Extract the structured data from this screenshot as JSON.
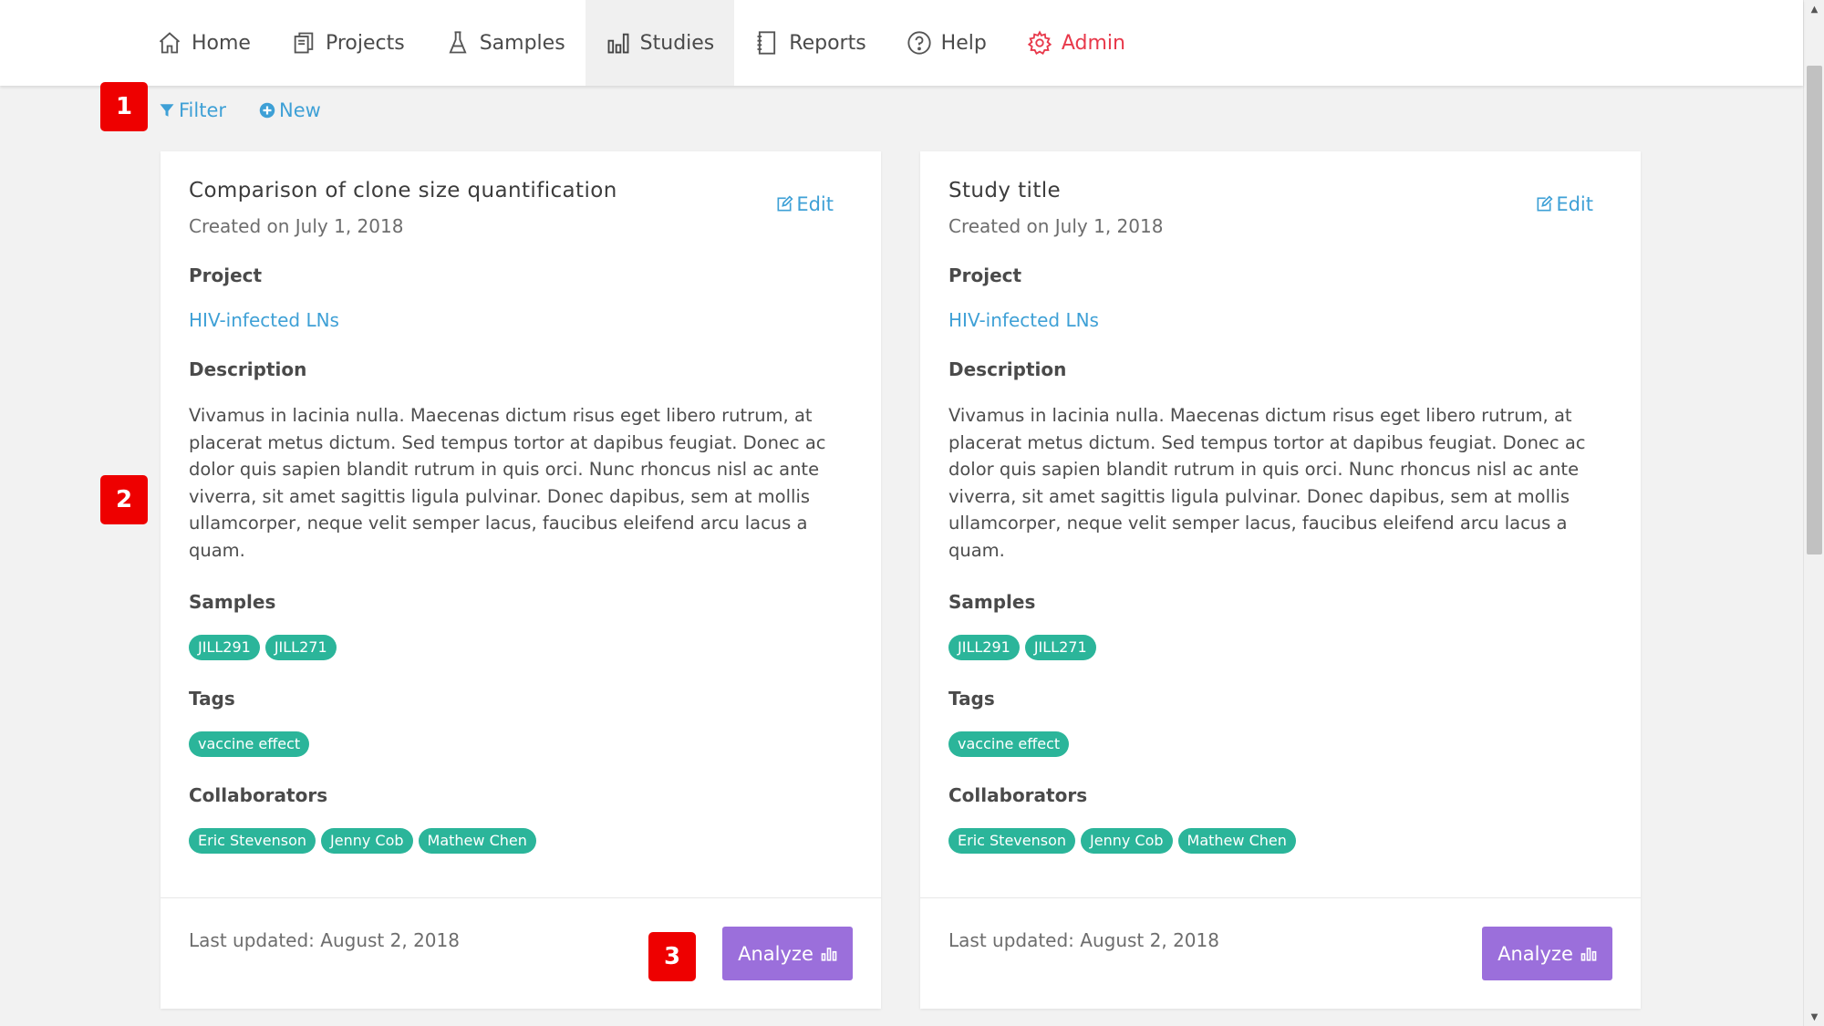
{
  "nav": {
    "items": [
      {
        "label": "Home",
        "icon": "home-icon"
      },
      {
        "label": "Projects",
        "icon": "projects-icon"
      },
      {
        "label": "Samples",
        "icon": "flask-icon"
      },
      {
        "label": "Studies",
        "icon": "bar-chart-icon",
        "active": true
      },
      {
        "label": "Reports",
        "icon": "notebook-icon"
      },
      {
        "label": "Help",
        "icon": "help-icon"
      },
      {
        "label": "Admin",
        "icon": "gear-icon"
      }
    ]
  },
  "toolbar": {
    "filter_label": "Filter",
    "new_label": "New"
  },
  "markers": [
    "1",
    "2",
    "3"
  ],
  "cards": [
    {
      "title": "Comparison of clone size quantification",
      "created": "Created on July 1, 2018",
      "edit_label": "Edit",
      "project_label": "Project",
      "project": "HIV-infected LNs",
      "description_label": "Description",
      "description": "Vivamus in lacinia nulla. Maecenas dictum risus eget libero rutrum, at placerat metus dictum. Sed tempus tortor at dapibus feugiat. Donec ac dolor quis sapien blandit rutrum in quis orci. Nunc rhoncus nisl ac ante viverra, sit amet sagittis ligula pulvinar. Donec dapibus, sem at mollis ullamcorper, neque velit semper lacus, faucibus eleifend arcu lacus a quam.",
      "samples_label": "Samples",
      "samples": [
        "JILL291",
        "JILL271"
      ],
      "tags_label": "Tags",
      "tags": [
        "vaccine effect"
      ],
      "collaborators_label": "Collaborators",
      "collaborators": [
        "Eric Stevenson",
        "Jenny Cob",
        "Mathew Chen"
      ],
      "updated": "Last updated: August 2, 2018",
      "analyze_label": "Analyze"
    },
    {
      "title": "Study title",
      "created": "Created on July 1, 2018",
      "edit_label": "Edit",
      "project_label": "Project",
      "project": "HIV-infected LNs",
      "description_label": "Description",
      "description": "Vivamus in lacinia nulla. Maecenas dictum risus eget libero rutrum, at placerat metus dictum. Sed tempus tortor at dapibus feugiat. Donec ac dolor quis sapien blandit rutrum in quis orci. Nunc rhoncus nisl ac ante viverra, sit amet sagittis ligula pulvinar. Donec dapibus, sem at mollis ullamcorper, neque velit semper lacus, faucibus eleifend arcu lacus a quam.",
      "samples_label": "Samples",
      "samples": [
        "JILL291",
        "JILL271"
      ],
      "tags_label": "Tags",
      "tags": [
        "vaccine effect"
      ],
      "collaborators_label": "Collaborators",
      "collaborators": [
        "Eric Stevenson",
        "Jenny Cob",
        "Mathew Chen"
      ],
      "updated": "Last updated: August 2, 2018",
      "analyze_label": "Analyze"
    }
  ],
  "colors": {
    "accent_link": "#3ea0d6",
    "pill": "#2bb59a",
    "analyze": "#9b6fdb",
    "admin": "#e8394b",
    "marker": "#ee0000"
  }
}
